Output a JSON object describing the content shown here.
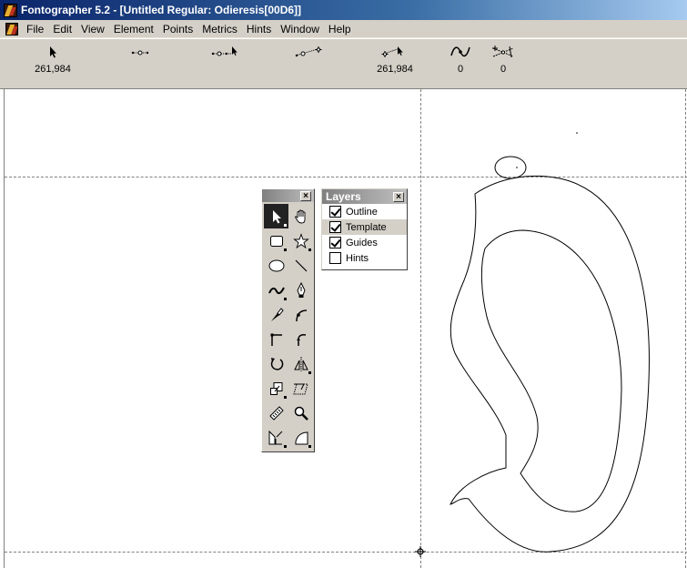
{
  "window": {
    "title": "Fontographer 5.2 - [Untitled Regular: Odieresis[00D6]]"
  },
  "menu": [
    "File",
    "Edit",
    "View",
    "Element",
    "Points",
    "Metrics",
    "Hints",
    "Window",
    "Help"
  ],
  "toolbar": {
    "items": [
      {
        "icon": "arrow-cursor-icon",
        "value": "261,984"
      },
      {
        "icon": "point-handles-icon",
        "value": ""
      },
      {
        "icon": "point-drag-icon",
        "value": ""
      },
      {
        "icon": "point-move-icon",
        "value": ""
      },
      {
        "icon": "point-offset-icon",
        "value": "261,984"
      },
      {
        "icon": "curve-icon",
        "value": "0"
      },
      {
        "icon": "hint-angle-icon",
        "value": "0"
      }
    ]
  },
  "tools": [
    "pointer-tool-icon",
    "hand-tool-icon",
    "rectangle-tool-icon",
    "star-tool-icon",
    "ellipse-tool-icon",
    "line-tool-icon",
    "freehand-tool-icon",
    "pen-tool-icon",
    "knife-tool-icon",
    "curve-point-tool-icon",
    "corner-point-tool-icon",
    "tangent-point-tool-icon",
    "rotate-tool-icon",
    "reflect-tool-icon",
    "scale-tool-icon",
    "skew-tool-icon",
    "measure-tool-icon",
    "zoom-tool-icon",
    "perspective-tool-icon",
    "calligraphy-tool-icon"
  ],
  "layers": {
    "title": "Layers",
    "items": [
      {
        "label": "Outline",
        "checked": true
      },
      {
        "label": "Template",
        "checked": true
      },
      {
        "label": "Guides",
        "checked": true
      },
      {
        "label": "Hints",
        "checked": false
      }
    ]
  }
}
